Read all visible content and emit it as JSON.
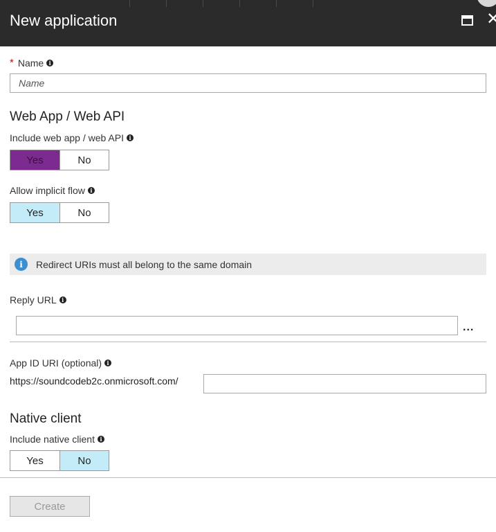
{
  "header": {
    "title": "New application"
  },
  "name_field": {
    "label": "Name",
    "placeholder": "Name",
    "value": ""
  },
  "web_section": {
    "heading": "Web App / Web API",
    "include_label": "Include web app / web API",
    "include_options": [
      "Yes",
      "No"
    ],
    "include_selected": "Yes",
    "implicit_label": "Allow implicit flow",
    "implicit_options": [
      "Yes",
      "No"
    ],
    "implicit_selected": "Yes"
  },
  "info_banner": {
    "text": "Redirect URIs must all belong to the same domain"
  },
  "reply_url": {
    "label": "Reply URL",
    "value": "",
    "more_label": "..."
  },
  "app_id_uri": {
    "label": "App ID URI (optional)",
    "prefix": "https://soundcodeb2c.onmicrosoft.com/",
    "value": ""
  },
  "native_section": {
    "heading": "Native client",
    "include_label": "Include native client",
    "options": [
      "Yes",
      "No"
    ],
    "selected": "No"
  },
  "footer": {
    "create_label": "Create"
  },
  "colors": {
    "header_bg": "#2b2b2b",
    "selected_purple": "#7b2a8f",
    "selected_blue": "#c4ecf8",
    "info_icon": "#3b8ed0",
    "required_star": "#e00000"
  }
}
